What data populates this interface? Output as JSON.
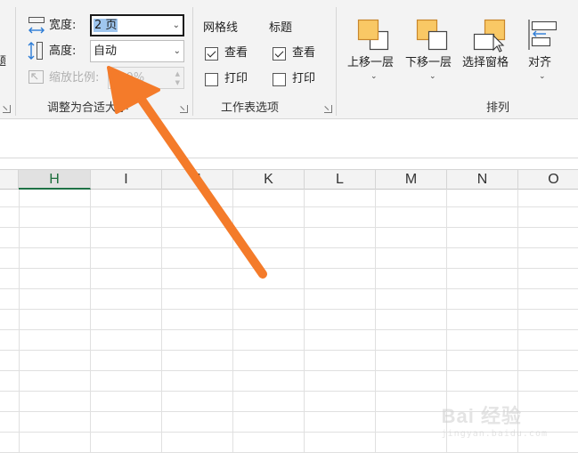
{
  "ribbon": {
    "scale_to_fit": {
      "group_title": "调整为合适大小",
      "width_label": "宽度:",
      "width_value": "2 页",
      "height_label": "高度:",
      "height_value": "自动",
      "scale_label": "缩放比例:",
      "scale_value": "100%"
    },
    "sheet_options": {
      "group_title": "工作表选项",
      "gridlines_title": "网格线",
      "headings_title": "标题",
      "gridlines_view_label": "查看",
      "gridlines_print_label": "打印",
      "headings_view_label": "查看",
      "headings_print_label": "打印",
      "gridlines_view_checked": true,
      "gridlines_print_checked": false,
      "headings_view_checked": true,
      "headings_print_checked": false
    },
    "arrange": {
      "group_title": "排列",
      "bring_forward": "上移一层",
      "send_backward": "下移一层",
      "selection_pane": "选择窗格",
      "align": "对齐"
    },
    "left_partial_text": "题"
  },
  "sheet": {
    "columns": [
      "H",
      "I",
      "J",
      "K",
      "L",
      "M",
      "N",
      "O"
    ],
    "active_column": "H"
  },
  "watermark": {
    "text": "Bai 经验",
    "sub": "jingyan.baidu.com"
  },
  "colors": {
    "arrow": "#f47b2a",
    "accent_green": "#1e7145",
    "selection_blue": "#9fc6ef",
    "shape_orange": "#f9c865"
  }
}
